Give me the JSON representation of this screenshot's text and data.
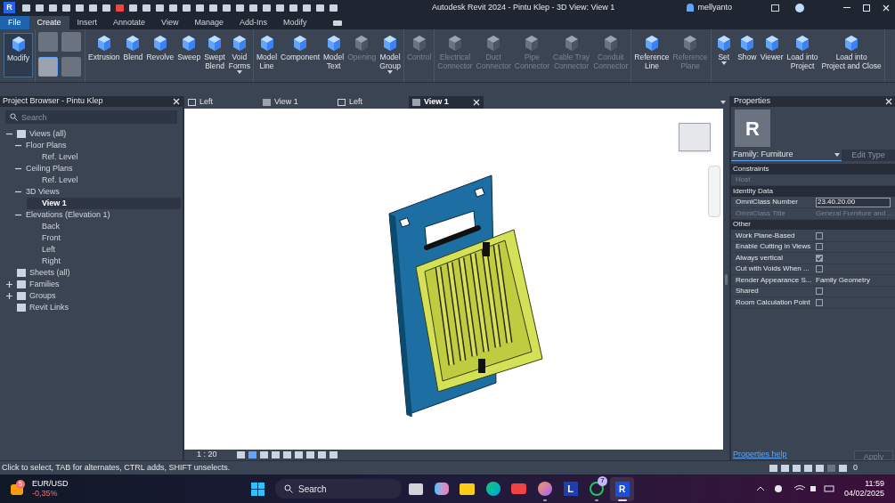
{
  "title_bar": {
    "logo": "R",
    "title": "Autodesk Revit 2024 - Pintu Klep - 3D View: View 1",
    "user": "mellyanto"
  },
  "ribbon_tabs": [
    {
      "label": "File",
      "selected": false,
      "kind": "file"
    },
    {
      "label": "Create",
      "selected": true,
      "kind": "tab"
    },
    {
      "label": "Insert",
      "selected": false,
      "kind": "tab"
    },
    {
      "label": "Annotate",
      "selected": false,
      "kind": "tab"
    },
    {
      "label": "View",
      "selected": false,
      "kind": "tab"
    },
    {
      "label": "Manage",
      "selected": false,
      "kind": "tab"
    },
    {
      "label": "Add-Ins",
      "selected": false,
      "kind": "tab"
    },
    {
      "label": "Modify",
      "selected": false,
      "kind": "tab"
    }
  ],
  "ribbon_groups": [
    {
      "tools": [
        {
          "label": "Modify",
          "disabled": false,
          "dropdown": false
        }
      ]
    },
    {
      "tools": [
        {
          "label": "Extrusion",
          "disabled": false,
          "dropdown": false
        },
        {
          "label": "Blend",
          "disabled": false,
          "dropdown": false
        },
        {
          "label": "Revolve",
          "disabled": false,
          "dropdown": false
        },
        {
          "label": "Sweep",
          "disabled": false,
          "dropdown": false
        },
        {
          "label": "Swept\nBlend",
          "disabled": false,
          "dropdown": false
        },
        {
          "label": "Void\nForms",
          "disabled": false,
          "dropdown": true
        }
      ]
    },
    {
      "tools": [
        {
          "label": "Model\nLine",
          "disabled": false,
          "dropdown": false
        },
        {
          "label": "Component",
          "disabled": false,
          "dropdown": false
        },
        {
          "label": "Model\nText",
          "disabled": false,
          "dropdown": false
        },
        {
          "label": "Opening",
          "disabled": true,
          "dropdown": false
        },
        {
          "label": "Model\nGroup",
          "disabled": false,
          "dropdown": true
        }
      ]
    },
    {
      "tools": [
        {
          "label": "Control",
          "disabled": true,
          "dropdown": false
        }
      ]
    },
    {
      "tools": [
        {
          "label": "Electrical\nConnector",
          "disabled": true,
          "dropdown": false
        },
        {
          "label": "Duct\nConnector",
          "disabled": true,
          "dropdown": false
        },
        {
          "label": "Pipe\nConnector",
          "disabled": true,
          "dropdown": false
        },
        {
          "label": "Cable Tray\nConnector",
          "disabled": true,
          "dropdown": false
        },
        {
          "label": "Conduit\nConnector",
          "disabled": true,
          "dropdown": false
        }
      ]
    },
    {
      "tools": [
        {
          "label": "Reference\nLine",
          "disabled": false,
          "dropdown": false
        },
        {
          "label": "Reference\nPlane",
          "disabled": true,
          "dropdown": false
        }
      ]
    },
    {
      "tools": [
        {
          "label": "Set",
          "disabled": false,
          "dropdown": true
        },
        {
          "label": "Show",
          "disabled": false,
          "dropdown": false
        },
        {
          "label": "Viewer",
          "disabled": false,
          "dropdown": false
        },
        {
          "label": "Load into\nProject",
          "disabled": false,
          "dropdown": false
        },
        {
          "label": "Load into\nProject and Close",
          "disabled": false,
          "dropdown": false
        }
      ]
    }
  ],
  "project_browser": {
    "title": "Project Browser - Pintu Klep",
    "search": {
      "placeholder": "Search"
    },
    "tree": [
      {
        "label": "Views (all)",
        "expanded": true,
        "selected": false,
        "children": [
          {
            "label": "Floor Plans",
            "expanded": true,
            "selected": false,
            "children": [
              {
                "label": "Ref. Level",
                "selected": false
              }
            ]
          },
          {
            "label": "Ceiling Plans",
            "expanded": true,
            "selected": false,
            "children": [
              {
                "label": "Ref. Level",
                "selected": false
              }
            ]
          },
          {
            "label": "3D Views",
            "expanded": true,
            "selected": false,
            "children": [
              {
                "label": "View 1",
                "selected": true
              }
            ]
          },
          {
            "label": "Elevations (Elevation 1)",
            "expanded": true,
            "selected": false,
            "children": [
              {
                "label": "Back",
                "selected": false
              },
              {
                "label": "Front",
                "selected": false
              },
              {
                "label": "Left",
                "selected": false
              },
              {
                "label": "Right",
                "selected": false
              }
            ]
          }
        ]
      },
      {
        "label": "Sheets (all)",
        "selected": false
      },
      {
        "label": "Families",
        "expanded": false,
        "selected": false
      },
      {
        "label": "Groups",
        "expanded": false,
        "selected": false
      },
      {
        "label": "Revit Links",
        "selected": false
      }
    ]
  },
  "view_tabs": [
    {
      "label": "Left",
      "selected": false,
      "kind": "elevation"
    },
    {
      "label": "View 1",
      "selected": false,
      "kind": "perspective"
    },
    {
      "label": "Left",
      "selected": false,
      "kind": "elevation"
    },
    {
      "label": "View 1",
      "selected": true,
      "kind": "perspective"
    }
  ],
  "view_control_bar": {
    "scale": "1 : 20"
  },
  "properties": {
    "title": "Properties",
    "type_logo": "R",
    "type_selector": "Family: Furniture",
    "edit_type": "Edit Type",
    "rows": [
      {
        "kind": "header",
        "label": "Constraints"
      },
      {
        "kind": "value",
        "label": "Host",
        "disabled": true
      },
      {
        "kind": "header",
        "label": "Identity Data"
      },
      {
        "kind": "field",
        "label": "OmniClass Number",
        "value": "23.40.20.00",
        "disabled": false
      },
      {
        "kind": "value",
        "label": "OmniClass Title",
        "value": "General Furniture and ...",
        "disabled": true
      },
      {
        "kind": "header",
        "label": "Other"
      },
      {
        "kind": "checkbox",
        "label": "Work Plane-Based",
        "checked": false
      },
      {
        "kind": "checkbox",
        "label": "Enable Cutting in Views",
        "checked": false
      },
      {
        "kind": "checkbox",
        "label": "Always vertical",
        "checked": true
      },
      {
        "kind": "checkbox",
        "label": "Cut with Voids When ...",
        "checked": false
      },
      {
        "kind": "value",
        "label": "Render Appearance S...",
        "value": "Family Geometry",
        "disabled": false
      },
      {
        "kind": "checkbox",
        "label": "Shared",
        "checked": false
      },
      {
        "kind": "checkbox",
        "label": "Room Calculation Point",
        "checked": false
      }
    ],
    "help_link": "Properties help",
    "apply": "Apply"
  },
  "status_bar": {
    "message": "Click to select, TAB for alternates, CTRL adds, SHIFT unselects.",
    "filter_count": "0"
  },
  "taskbar": {
    "widget": {
      "badge": "5",
      "title": "EUR/USD",
      "change": "-0,35%"
    },
    "search": {
      "placeholder": "Search"
    },
    "apps": [
      {
        "kind": "taskview",
        "running": false
      },
      {
        "kind": "copilot",
        "running": false
      },
      {
        "kind": "explorer",
        "running": false
      },
      {
        "kind": "edge",
        "running": false
      },
      {
        "kind": "youtube",
        "running": false
      },
      {
        "kind": "firefox",
        "running": true
      },
      {
        "kind": "letter",
        "letter": "L",
        "running": false
      },
      {
        "kind": "whatsapp",
        "badge": "7",
        "running": true
      },
      {
        "kind": "revit",
        "letter": "R",
        "running": true,
        "selected": true
      }
    ],
    "time": "11:59",
    "date": "04/02/2025"
  }
}
